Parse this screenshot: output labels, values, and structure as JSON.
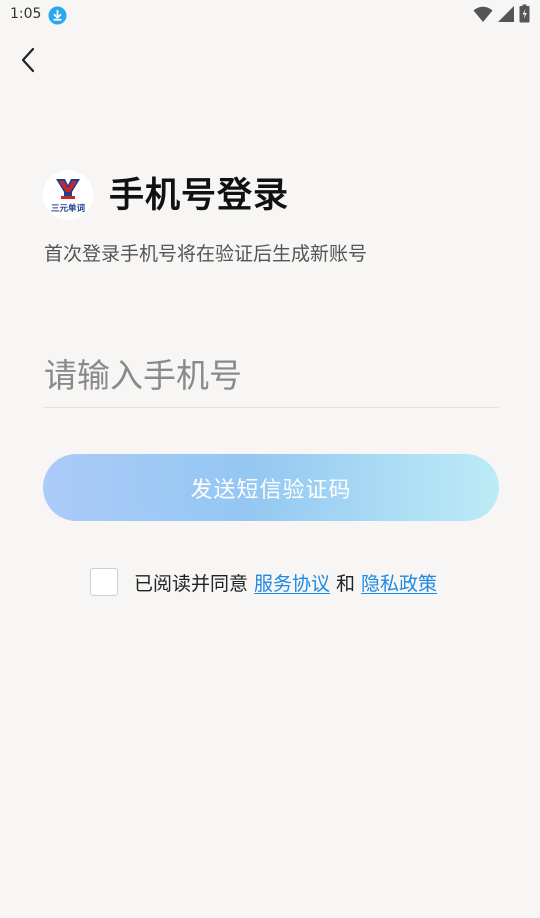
{
  "status_bar": {
    "time": "1:05",
    "icons": [
      "download-icon",
      "wifi-icon",
      "signal-icon",
      "battery-icon"
    ]
  },
  "navigation": {
    "back_icon": "chevron-left-icon"
  },
  "header": {
    "logo_text": "三元单词",
    "title": "手机号登录",
    "subtitle": "首次登录手机号将在验证后生成新账号"
  },
  "form": {
    "phone_placeholder": "请输入手机号",
    "phone_value": "",
    "send_code_label": "发送短信验证码"
  },
  "agreement": {
    "checked": false,
    "prefix": "已阅读并同意",
    "terms_link": "服务协议",
    "conjunction": "和",
    "privacy_link": "隐私政策"
  },
  "colors": {
    "background": "#f7f6f4",
    "link": "#1e88e5",
    "button_gradient_start": "#a8c8fa",
    "button_gradient_end": "#b9ebf6",
    "download_badge": "#29a8ec"
  }
}
